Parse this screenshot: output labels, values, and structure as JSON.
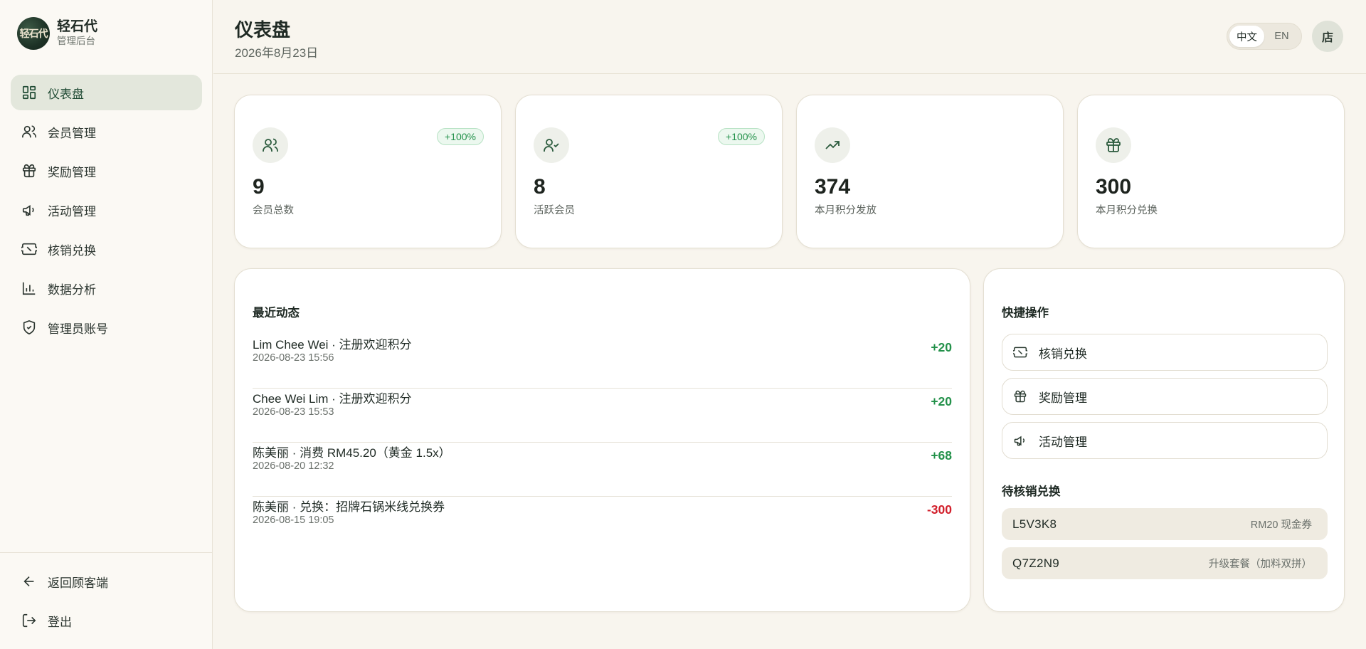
{
  "brand": {
    "name": "轻石代",
    "subtitle": "管理后台",
    "logo_text": "轻石代"
  },
  "nav": {
    "items": [
      {
        "label": "仪表盘",
        "icon": "dashboard-icon",
        "active": true
      },
      {
        "label": "会员管理",
        "icon": "users-icon"
      },
      {
        "label": "奖励管理",
        "icon": "gift-icon"
      },
      {
        "label": "活动管理",
        "icon": "megaphone-icon"
      },
      {
        "label": "核销兑换",
        "icon": "ticket-icon"
      },
      {
        "label": "数据分析",
        "icon": "bar-chart-icon"
      },
      {
        "label": "管理员账号",
        "icon": "shield-icon"
      }
    ],
    "bottom": [
      {
        "label": "返回顾客端",
        "icon": "arrow-left-icon"
      },
      {
        "label": "登出",
        "icon": "logout-icon"
      }
    ]
  },
  "header": {
    "title": "仪表盘",
    "date": "2026年8月23日",
    "lang": {
      "zh": "中文",
      "en": "EN",
      "active": "zh"
    },
    "avatar": "店"
  },
  "stats": [
    {
      "value": "9",
      "label": "会员总数",
      "badge": "+100%",
      "icon": "users-icon"
    },
    {
      "value": "8",
      "label": "活跃会员",
      "badge": "+100%",
      "icon": "user-check-icon"
    },
    {
      "value": "374",
      "label": "本月积分发放",
      "badge": null,
      "icon": "trending-up-icon"
    },
    {
      "value": "300",
      "label": "本月积分兑换",
      "badge": null,
      "icon": "gift-icon"
    }
  ],
  "activity": {
    "title": "最近动态",
    "rows": [
      {
        "title": "Lim Chee Wei · 注册欢迎积分",
        "time": "2026-08-23 15:56",
        "points": "+20"
      },
      {
        "title": "Chee Wei Lim · 注册欢迎积分",
        "time": "2026-08-23 15:53",
        "points": "+20"
      },
      {
        "title": "陈美丽 · 消费 RM45.20（黄金 1.5x）",
        "time": "2026-08-20 12:32",
        "points": "+68"
      },
      {
        "title": "陈美丽 · 兑换：招牌石锅米线兑换券",
        "time": "2026-08-15 19:05",
        "points": "-300"
      }
    ]
  },
  "quick": {
    "title": "快捷操作",
    "actions": [
      {
        "label": "核销兑换",
        "icon": "ticket-icon"
      },
      {
        "label": "奖励管理",
        "icon": "gift-icon"
      },
      {
        "label": "活动管理",
        "icon": "megaphone-icon"
      }
    ],
    "pending_title": "待核销兑换",
    "pending": [
      {
        "code": "L5V3K8",
        "desc": "RM20 现金券"
      },
      {
        "code": "Q7Z2N9",
        "desc": "升级套餐（加料双拼）"
      }
    ]
  },
  "colors": {
    "accent": "#1f4a33",
    "positive": "#23914a",
    "negative": "#d21f2b",
    "background": "#f8f5ee"
  }
}
